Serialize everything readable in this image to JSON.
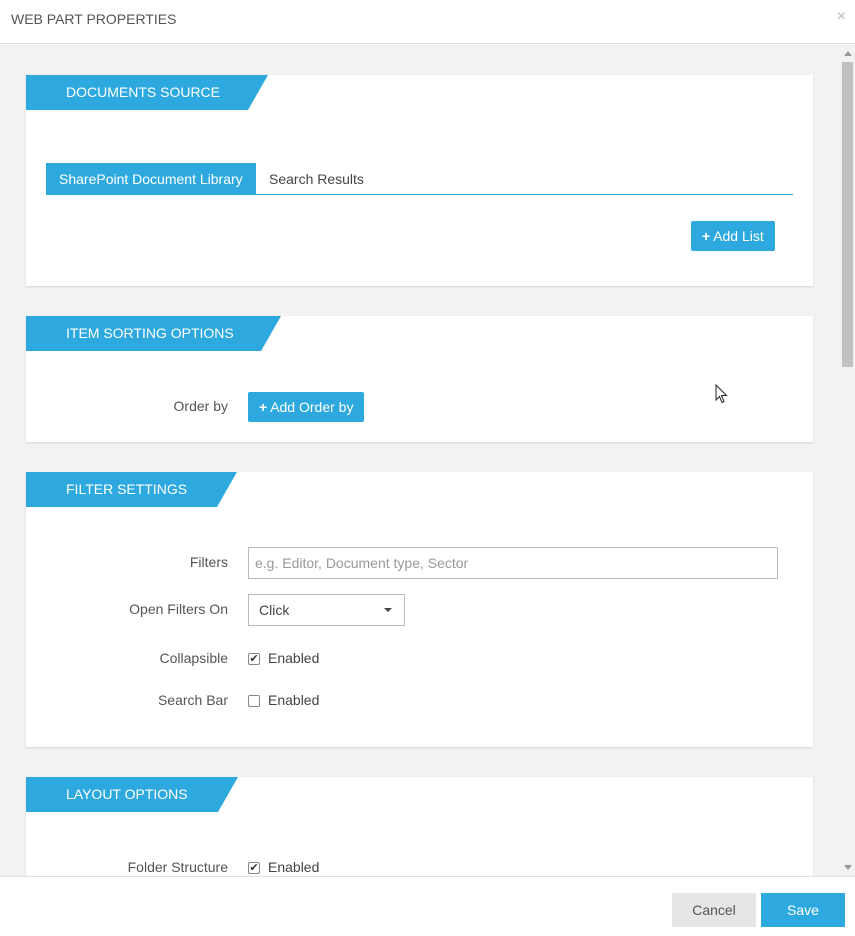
{
  "dialog": {
    "title": "WEB PART PROPERTIES",
    "close_glyph": "×"
  },
  "documents_source": {
    "header": "DOCUMENTS SOURCE",
    "tabs": [
      {
        "label": "SharePoint Document Library",
        "active": true
      },
      {
        "label": "Search Results",
        "active": false
      }
    ],
    "add_list_label": "Add List"
  },
  "item_sorting": {
    "header": "ITEM SORTING OPTIONS",
    "order_by_label": "Order by",
    "add_order_by_label": "Add Order by"
  },
  "filter_settings": {
    "header": "FILTER SETTINGS",
    "filters_label": "Filters",
    "filters_placeholder": "e.g. Editor, Document type, Sector",
    "open_filters_on_label": "Open Filters On",
    "open_filters_on_value": "Click",
    "collapsible_label": "Collapsible",
    "collapsible_checked": true,
    "collapsible_option": "Enabled",
    "search_bar_label": "Search Bar",
    "search_bar_checked": false,
    "search_bar_option": "Enabled"
  },
  "layout_options": {
    "header": "LAYOUT OPTIONS",
    "folder_structure_label": "Folder Structure",
    "folder_structure_checked": true,
    "folder_structure_option": "Enabled"
  },
  "footer": {
    "cancel_label": "Cancel",
    "save_label": "Save"
  },
  "colors": {
    "accent": "#2ea9e0",
    "background": "#f2f2f2",
    "cancel_bg": "#e6e6e6"
  },
  "icons": {
    "plus": "plus-icon",
    "check": "checkmark-icon",
    "dropdown": "chevron-down-icon",
    "close": "close-icon"
  }
}
